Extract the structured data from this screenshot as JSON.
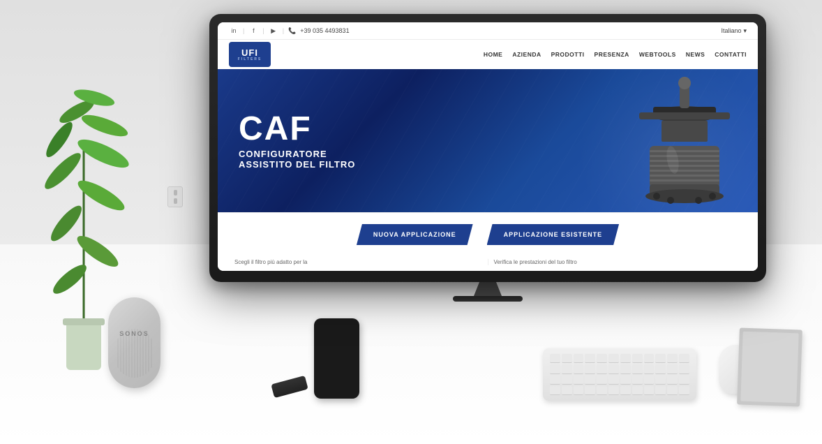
{
  "scene": {
    "background_color": "#eeeeee"
  },
  "sonos": {
    "brand_label": "SONOS"
  },
  "website": {
    "topbar": {
      "phone": "+39 035 4493831",
      "language": "Italiano",
      "language_dropdown": "▾"
    },
    "logo": {
      "text": "UFI",
      "subtext": "FILTERS"
    },
    "nav": {
      "items": [
        "HOME",
        "AZIENDA",
        "PRODOTTI",
        "PRESENZA",
        "WEBTOOLS",
        "NEWS",
        "CONTATTI"
      ]
    },
    "hero": {
      "title": "CAF",
      "subtitle1": "CONFIGURATORE",
      "subtitle2": "ASSISTITO DEL FILTRO"
    },
    "buttons": {
      "primary": "NUOVA APPLICAZIONE",
      "secondary": "APPLICAZIONE ESISTENTE"
    },
    "bottom": {
      "col1": "Scegli il filtro più adatto per la",
      "col2": "Verifica le prestazioni del tuo filtro"
    }
  }
}
